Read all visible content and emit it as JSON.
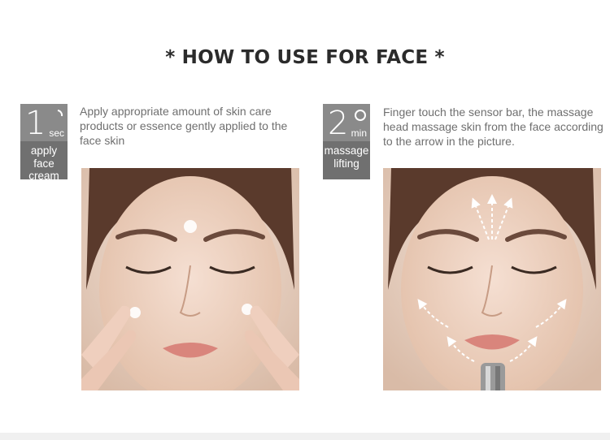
{
  "heading": "* HOW TO USE FOR FACE *",
  "steps": [
    {
      "number": "1",
      "unit": "sec",
      "label": "apply face cream",
      "label_lines": [
        "apply",
        "face",
        "cream"
      ],
      "icon": "arc-icon",
      "description": "Apply appropriate amount of skin care products or essence gently applied to the face skin",
      "image": "face-applying-cream-photo"
    },
    {
      "number": "2",
      "unit": "min",
      "label": "massage lifting",
      "label_lines": [
        "massage",
        "lifting"
      ],
      "icon": "circle-icon",
      "description": "Finger touch the sensor bar, the massage head massage skin from the face according to the arrow in the picture.",
      "image": "face-massage-arrows-photo"
    }
  ],
  "colors": {
    "badge_bg": "#707070",
    "badge_top": "#8a8a8a",
    "heading": "#2b2b2b",
    "text": "#6f6f6f",
    "skin": "#e8cdbb"
  }
}
